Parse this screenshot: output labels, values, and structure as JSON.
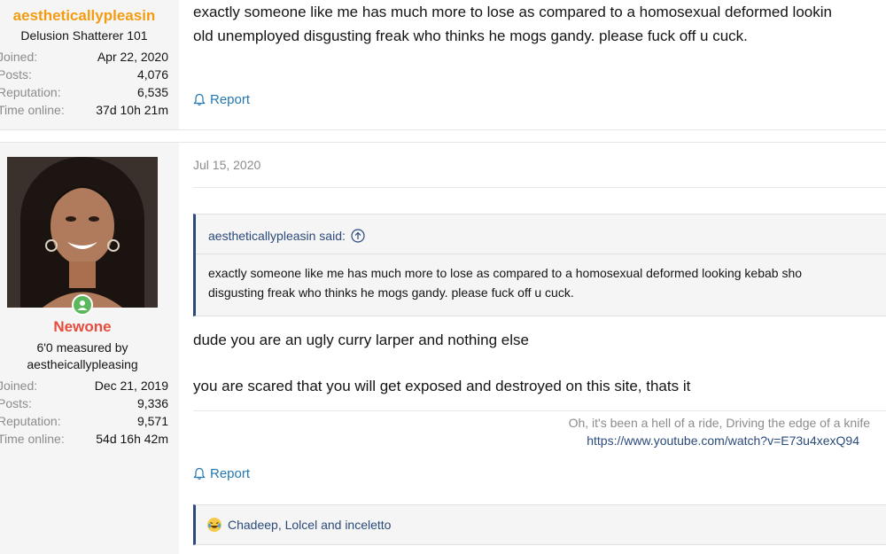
{
  "post1": {
    "username": "aestheticallypleasin",
    "user_title": "Delusion Shatterer 101",
    "stats": [
      {
        "label": "Joined:",
        "value": "Apr 22, 2020"
      },
      {
        "label": "Posts:",
        "value": "4,076"
      },
      {
        "label": "Reputation:",
        "value": "6,535"
      },
      {
        "label": "Time online:",
        "value": "37d 10h 21m"
      }
    ],
    "message_line1": "exactly someone like me has much more to lose as compared to a homosexual deformed lookin",
    "message_line2": "old unemployed disgusting freak who thinks he mogs gandy. please fuck off u cuck.",
    "report_label": "Report"
  },
  "post2": {
    "username": "Newone",
    "user_title_line1": "6'0 measured by",
    "user_title_line2": "aestheicallypleasing",
    "stats": [
      {
        "label": "Joined:",
        "value": "Dec 21, 2019"
      },
      {
        "label": "Posts:",
        "value": "9,336"
      },
      {
        "label": "Reputation:",
        "value": "9,571"
      },
      {
        "label": "Time online:",
        "value": "54d 16h 42m"
      }
    ],
    "date": "Jul 15, 2020",
    "quote": {
      "author_said": "aestheticallypleasin said:",
      "line1": "exactly someone like me has much more to lose as compared to a homosexual deformed looking kebab sho",
      "line2": "disgusting freak who thinks he mogs gandy. please fuck off u cuck."
    },
    "message_line1": "dude you are an ugly curry larper and nothing else",
    "message_line2": "you are scared that you will get exposed and destroyed on this site, thats it",
    "signature_line1": "Oh, it's been a hell of a ride, Driving the edge of a knife",
    "signature_link": "https://www.youtube.com/watch?v=E73u4xexQ94",
    "report_label": "Report",
    "reactions_text": "Chadeep, Lolcel and inceletto"
  },
  "colors": {
    "username1": "#f39c12",
    "username2": "#e74c3c",
    "link": "#2577b1",
    "quote_accent": "#2a4a7a",
    "online": "#5cb85c"
  },
  "icons": [
    "bell-icon",
    "arrow-up-circle-icon",
    "online-status-icon",
    "laughing-emoji-icon"
  ]
}
